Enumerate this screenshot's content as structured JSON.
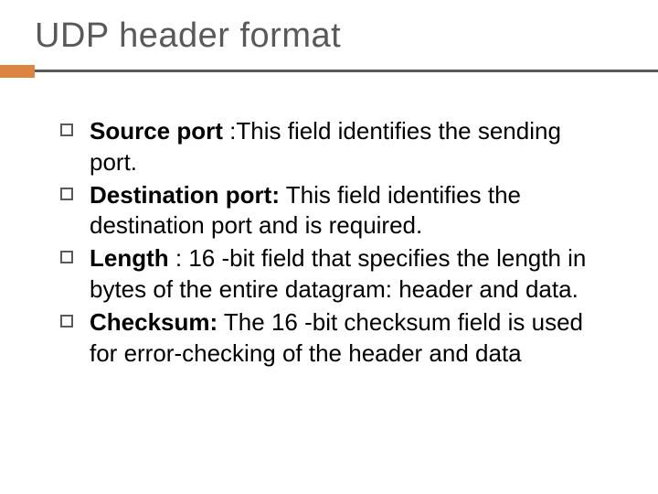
{
  "title": "UDP header format",
  "items": [
    {
      "term": "Source port ",
      "colon": ":",
      "desc": "This field identifies the sending port."
    },
    {
      "term": "Destination port:",
      "colon": " ",
      "desc": "This field identifies the destination port and is required."
    },
    {
      "term": "Length ",
      "colon": ":",
      "desc": " 16 -bit field that specifies the length in bytes of the entire datagram: header and data."
    },
    {
      "term": "Checksum:",
      "colon": " ",
      "desc": "The 16 -bit checksum field is used for error-checking of the header and data"
    }
  ]
}
